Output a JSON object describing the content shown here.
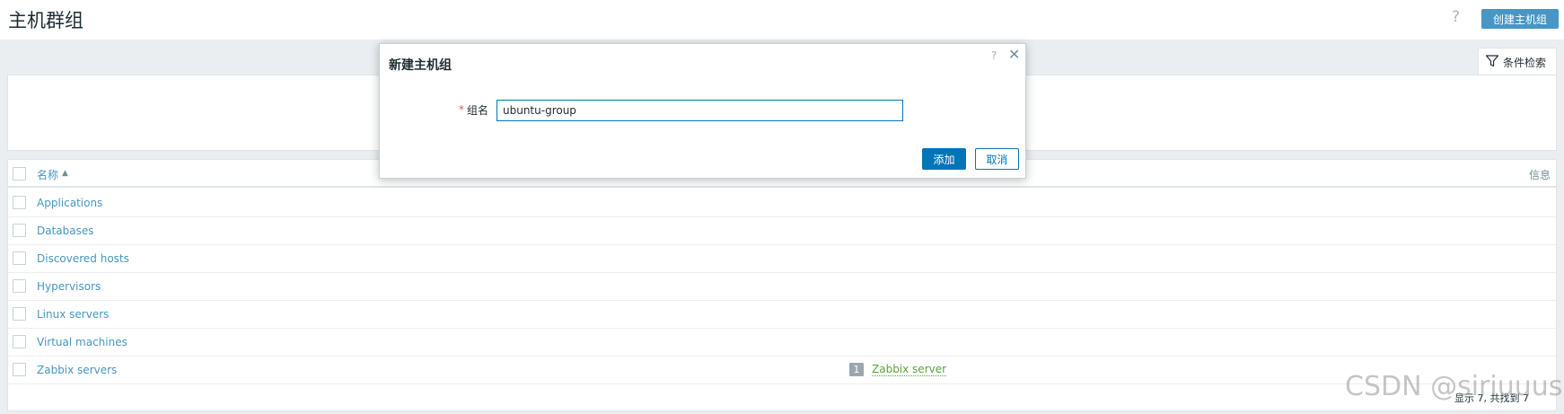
{
  "header": {
    "title": "主机群组",
    "help_glyph": "?",
    "create_button": "创建主机组"
  },
  "filter": {
    "tab_label": "条件检索",
    "icon": "filter-icon"
  },
  "table": {
    "col_name": "名称",
    "sort_glyph": "▲",
    "col_info": "信息",
    "rows": [
      {
        "name": "Applications"
      },
      {
        "name": "Databases"
      },
      {
        "name": "Discovered hosts"
      },
      {
        "name": "Hypervisors"
      },
      {
        "name": "Linux servers"
      },
      {
        "name": "Virtual machines"
      },
      {
        "name": "Zabbix servers",
        "count": "1",
        "host": "Zabbix server"
      }
    ],
    "footer": "显示 7, 共找到 7"
  },
  "dialog": {
    "title": "新建主机组",
    "help_glyph": "?",
    "close_glyph": "✕",
    "required_mark": "*",
    "field_label": "组名",
    "field_value": "ubuntu-group",
    "add_button": "添加",
    "cancel_button": "取消"
  },
  "watermark": "CSDN @siriuuus",
  "colors": {
    "link": "#4796c4",
    "primary": "#0275b8",
    "host_link": "#59a33d",
    "required": "#e45959"
  }
}
